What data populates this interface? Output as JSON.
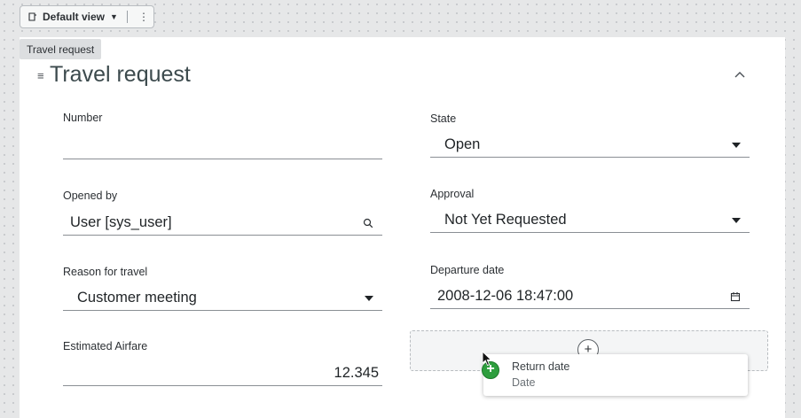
{
  "toolbar": {
    "view_label": "Default view",
    "view_icon": "view-layout-icon",
    "caret_icon": "caret-down-icon",
    "more_icon": "more-vertical-icon",
    "more_glyph": "⋮"
  },
  "form": {
    "section_tag": "Travel request",
    "title": "Travel request",
    "drag_handle_glyph": "≡",
    "collapse_icon": "chevron-up-icon"
  },
  "fields": {
    "number": {
      "label": "Number",
      "value": ""
    },
    "state": {
      "label": "State",
      "value": "Open"
    },
    "opened_by": {
      "label": "Opened by",
      "value": "User [sys_user]",
      "icon": "search-icon"
    },
    "approval": {
      "label": "Approval",
      "value": "Not Yet Requested"
    },
    "reason": {
      "label": "Reason for travel",
      "value": "Customer meeting"
    },
    "departure": {
      "label": "Departure date",
      "value": "2008-12-06 18:47:00",
      "icon": "calendar-icon"
    },
    "airfare": {
      "label": "Estimated Airfare",
      "value": "12.345"
    }
  },
  "dropzone": {
    "add_glyph": "+"
  },
  "drag_preview": {
    "title": "Return date",
    "subtitle": "Date",
    "plus_glyph": "+"
  },
  "colors": {
    "accent_green": "#2e9e3e",
    "title_color": "#3c4a4d",
    "background": "#e6e7e8"
  }
}
